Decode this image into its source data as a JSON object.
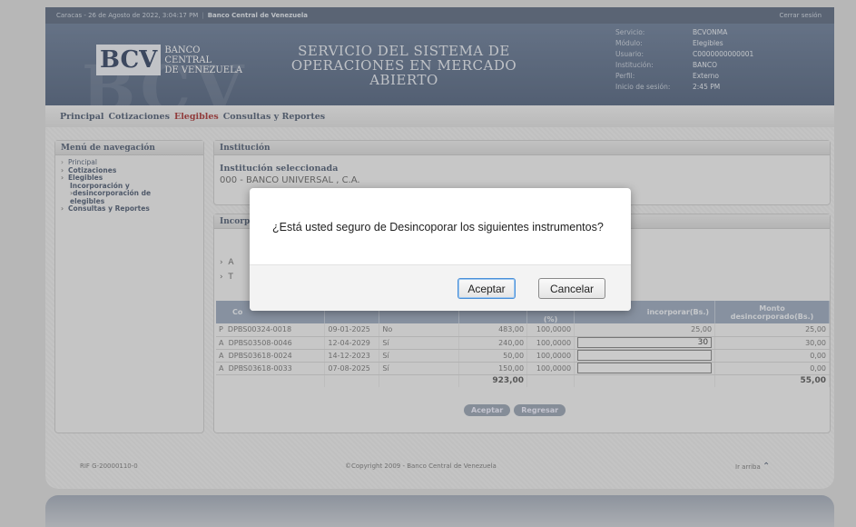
{
  "topbar": {
    "datetime": "Caracas - 26 de Agosto de 2022, 3:04:17 PM",
    "separator": "|",
    "bank": "Banco Central de Venezuela",
    "logout": "Cerrar sesión"
  },
  "banner": {
    "logo_mark": "BCV",
    "logo_lines": [
      "BANCO",
      "CENTRAL",
      "DE VENEZUELA"
    ],
    "title_lines": [
      "SERVICIO DEL SISTEMA DE",
      "OPERACIONES EN MERCADO",
      "ABIERTO"
    ],
    "session": [
      {
        "k": "Servicio:",
        "v": "BCVONMA"
      },
      {
        "k": "Módulo:",
        "v": "Elegibles"
      },
      {
        "k": "Usuario:",
        "v": "C0000000000001"
      },
      {
        "k": "Institución:",
        "v": "BANCO"
      },
      {
        "k": "Perfil:",
        "v": "Externo"
      },
      {
        "k": "Inicio de sesión:",
        "v": "2:45 PM"
      }
    ]
  },
  "nav": {
    "items": [
      "Principal",
      "Cotizaciones",
      "Elegibles",
      "Consultas y Reportes"
    ],
    "active_index": 2
  },
  "side": {
    "title": "Menú de navegación",
    "items": {
      "principal": "Principal",
      "cotizaciones": "Cotizaciones",
      "elegibles": "Elegibles",
      "sub1": "Incorporación y",
      "sub2": "desincorporación de",
      "sub3": "elegibles",
      "consultas": "Consultas y Reportes"
    }
  },
  "institucion": {
    "title": "Institución",
    "selected_label": "Institución seleccionada",
    "selected_value": "000 - BANCO UNIVERSAL , C.A."
  },
  "incorp": {
    "title": "Incorpo",
    "bullets": [
      "A",
      "T"
    ],
    "headers": {
      "c1": "Co",
      "c5": "(%)",
      "c6": "incorporar(Bs.)",
      "c7a": "Monto",
      "c7b": "desincorporado(Bs.)"
    },
    "rows": [
      {
        "t": "P",
        "code": "DPBS00324-0018",
        "date": "09-01-2025",
        "flag": "No",
        "amount": "483,00",
        "pct": "100,0000",
        "input": "",
        "fixed": "25,00",
        "mdes": "25,00"
      },
      {
        "t": "A",
        "code": "DPBS03508-0046",
        "date": "12-04-2029",
        "flag": "Sí",
        "amount": "240,00",
        "pct": "100,0000",
        "input": "30",
        "fixed": "",
        "mdes": "30,00"
      },
      {
        "t": "A",
        "code": "DPBS03618-0024",
        "date": "14-12-2023",
        "flag": "Sí",
        "amount": "50,00",
        "pct": "100,0000",
        "input": "",
        "fixed": "",
        "mdes": "0,00"
      },
      {
        "t": "A",
        "code": "DPBS03618-0033",
        "date": "07-08-2025",
        "flag": "Sí",
        "amount": "150,00",
        "pct": "100,0000",
        "input": "",
        "fixed": "",
        "mdes": "0,00"
      }
    ],
    "total_amount": "923,00",
    "total_mdes": "55,00",
    "btn_accept": "Aceptar",
    "btn_back": "Regresar"
  },
  "footer": {
    "rif": "RIF G-20000110-0",
    "copyright": "©Copyright 2009 - Banco Central de Venezuela",
    "top": "Ir arriba"
  },
  "modal": {
    "message": "¿Está usted seguro de Desincoporar los siguientes instrumentos?",
    "ok": "Aceptar",
    "cancel": "Cancelar"
  }
}
